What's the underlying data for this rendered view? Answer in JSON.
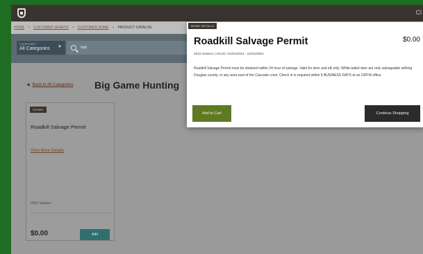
{
  "app": {
    "corner_text": "Cl"
  },
  "breadcrumb": {
    "items": [
      "HOME",
      "CUSTOMER SEARCH",
      "CUSTOMER HOME",
      "PRODUCT CATALOG"
    ],
    "separator": ">"
  },
  "search": {
    "category_label": "CATEGORY",
    "category_value": "All Categories",
    "query": "rod",
    "placeholder": ""
  },
  "page": {
    "back_label": "Back to All Categories",
    "title": "Big Game Hunting"
  },
  "card": {
    "badge": "OTHER",
    "title": "Roadkill Salvage Permit",
    "details_link": "View More Details",
    "season": "2022 Season",
    "price": "$0.00",
    "add_label": "Add"
  },
  "modal": {
    "badge": "MORE DETAILS",
    "title": "Roadkill Salvage Permit",
    "price": "$0.00",
    "meta": "2022 Season | VALID: 01/01/2022 - 12/31/2052",
    "description": "Roadkill Salvage Permit must be obtained within 24 hour of salvage. Valid for deer and elk only. White-tailed deer are only salvageable withing Douglas county, or any area east of the Cascade crest. Check in is required within 5 BUSINESS DAYS at an ODFW office.",
    "add_to_cart_label": "Add to Cart",
    "continue_label": "Continue Shopping"
  },
  "colors": {
    "outer_border": "#1f6d22",
    "topbar": "#3a3430",
    "add_to_cart": "#5e7a23",
    "continue": "#2b2b2b",
    "card_add": "#2f6f6e"
  }
}
